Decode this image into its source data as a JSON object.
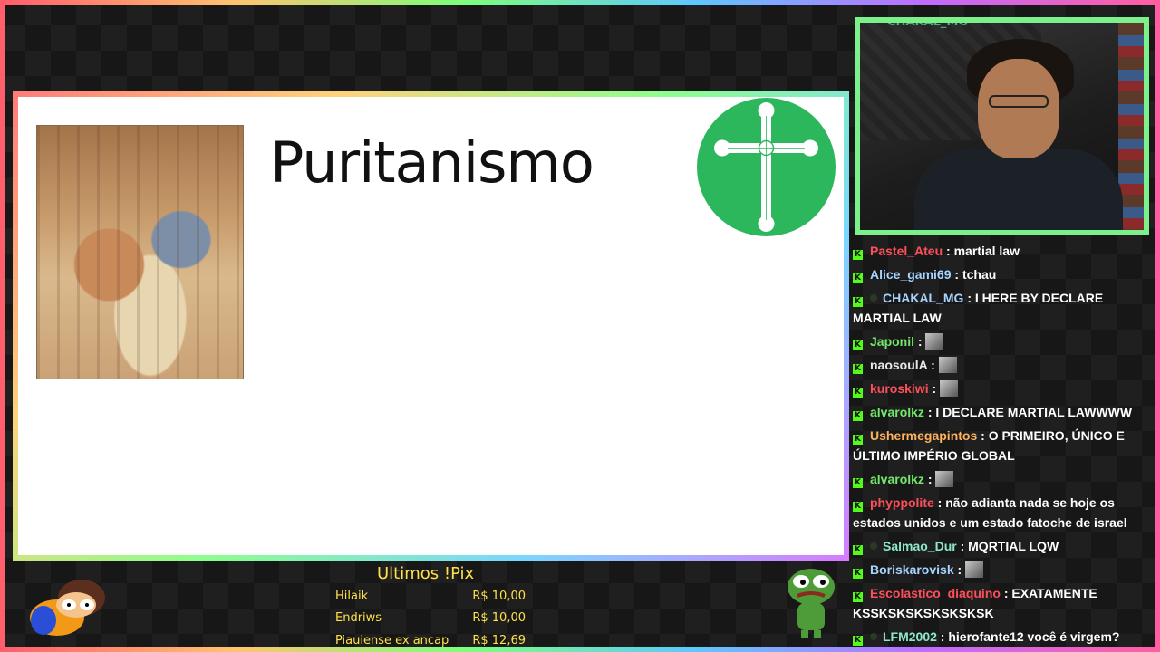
{
  "slide": {
    "title": "Puritanismo"
  },
  "webcam": {
    "overlay_user": "CHAKAL_MG"
  },
  "chat": {
    "messages": [
      {
        "user": "Pastel_Ateu",
        "color": "#ff4f5a",
        "text": " : martial law",
        "badge": false,
        "emote": false
      },
      {
        "user": "Alice_gami69",
        "color": "#a7d4ff",
        "text": " : tchau",
        "badge": false,
        "emote": false
      },
      {
        "user": "CHAKAL_MG",
        "color": "#a7d4ff",
        "text": " : I HERE BY DECLARE MARTIAL LAW",
        "badge": true,
        "emote": false
      },
      {
        "user": "Japonil",
        "color": "#72e86b",
        "text": " : ",
        "badge": false,
        "emote": true
      },
      {
        "user": "naosoulA",
        "color": "#e8e8e8",
        "text": " : ",
        "badge": false,
        "emote": true
      },
      {
        "user": "kuroskiwi",
        "color": "#ff4f5a",
        "text": " : ",
        "badge": false,
        "emote": true
      },
      {
        "user": "alvarolkz",
        "color": "#72e86b",
        "text": " : I DECLARE MARTIAL LAWWWW",
        "badge": false,
        "emote": false
      },
      {
        "user": "Ushermegapintos",
        "color": "#ffb15c",
        "text": " : O PRIMEIRO, ÚNICO E ÚLTIMO IMPÉRIO GLOBAL",
        "badge": false,
        "emote": false
      },
      {
        "user": "alvarolkz",
        "color": "#72e86b",
        "text": " : ",
        "badge": false,
        "emote": true
      },
      {
        "user": "phyppolite",
        "color": "#ff4f5a",
        "text": " : não adianta nada se hoje os estados unidos e um estado fatoche de israel",
        "badge": false,
        "emote": false
      },
      {
        "user": "Salmao_Dur",
        "color": "#8de8c8",
        "text": " : MQRTIAL LQW",
        "badge": true,
        "emote": false
      },
      {
        "user": "Boriskarovisk",
        "color": "#a7d4ff",
        "text": " : ",
        "badge": false,
        "emote": true
      },
      {
        "user": "Escolastico_diaquino",
        "color": "#ff4f5a",
        "text": " : EXATAMENTE KSSKSKSKSKSKSKSK",
        "badge": false,
        "emote": false
      },
      {
        "user": "LFM2002",
        "color": "#8de8c8",
        "text": " : hierofante12 você é virgem?",
        "badge": true,
        "emote": false
      }
    ]
  },
  "pix": {
    "title": "Ultimos !Pix",
    "rows": [
      {
        "name": "Hilaik",
        "amount": "R$ 10,00"
      },
      {
        "name": "Endriws",
        "amount": "R$ 10,00"
      },
      {
        "name": "Piauiense ex ancap",
        "amount": "R$ 12,69"
      }
    ]
  },
  "colors": {
    "accent_green": "#53fc18",
    "pix_yellow": "#ffe14a",
    "webcam_border": "#7cf08a",
    "cross_badge": "#2db75d"
  },
  "icons": {
    "kick": "kick-icon",
    "cross": "cross-icon"
  }
}
